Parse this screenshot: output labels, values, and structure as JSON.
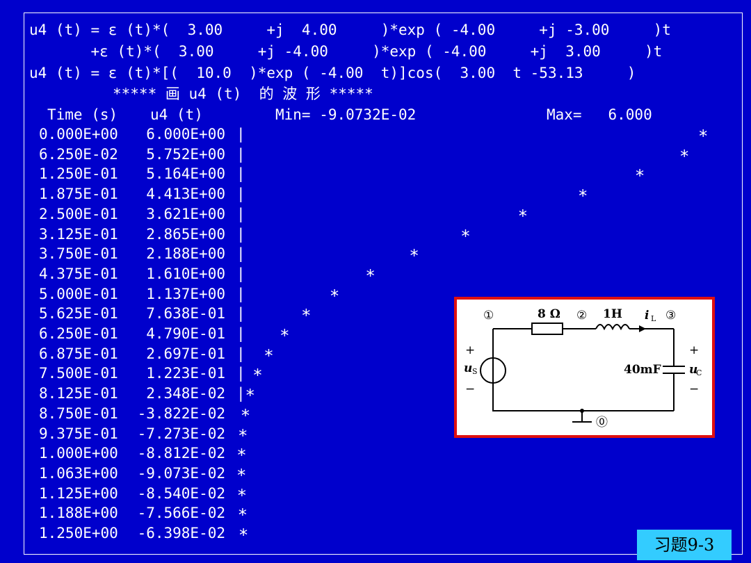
{
  "header": {
    "line1": "u4 (t) = ε (t)*(  3.00     +j  4.00     )*exp ( -4.00     +j -3.00     )t",
    "line2": "       +ε (t)*(  3.00     +j -4.00     )*exp ( -4.00     +j  3.00     )t",
    "line3": "u4 (t) = ε (t)*[(  10.0  )*exp ( -4.00  t)]cos(  3.00  t -53.13     )",
    "plot_title": "***** 画 u4 (t)  的 波 形 *****",
    "col_time": "Time (s)",
    "col_u": "u4 (t)",
    "min_label": "Min= -9.0732E-02",
    "max_label": "Max=   6.000"
  },
  "rows": [
    {
      "t": "0.000E+00",
      "u": "6.000E+00",
      "v": 6.0
    },
    {
      "t": "6.250E-02",
      "u": "5.752E+00",
      "v": 5.752
    },
    {
      "t": "1.250E-01",
      "u": "5.164E+00",
      "v": 5.164
    },
    {
      "t": "1.875E-01",
      "u": "4.413E+00",
      "v": 4.413
    },
    {
      "t": "2.500E-01",
      "u": "3.621E+00",
      "v": 3.621
    },
    {
      "t": "3.125E-01",
      "u": "2.865E+00",
      "v": 2.865
    },
    {
      "t": "3.750E-01",
      "u": "2.188E+00",
      "v": 2.188
    },
    {
      "t": "4.375E-01",
      "u": "1.610E+00",
      "v": 1.61
    },
    {
      "t": "5.000E-01",
      "u": "1.137E+00",
      "v": 1.137
    },
    {
      "t": "5.625E-01",
      "u": "7.638E-01",
      "v": 0.7638
    },
    {
      "t": "6.250E-01",
      "u": "4.790E-01",
      "v": 0.479
    },
    {
      "t": "6.875E-01",
      "u": "2.697E-01",
      "v": 0.2697
    },
    {
      "t": "7.500E-01",
      "u": "1.223E-01",
      "v": 0.1223
    },
    {
      "t": "8.125E-01",
      "u": "2.348E-02",
      "v": 0.02348
    },
    {
      "t": "8.750E-01",
      "u": "-3.822E-02",
      "v": -0.03822
    },
    {
      "t": "9.375E-01",
      "u": "-7.273E-02",
      "v": -0.07273
    },
    {
      "t": "1.000E+00",
      "u": "-8.812E-02",
      "v": -0.08812
    },
    {
      "t": "1.063E+00",
      "u": "-9.073E-02",
      "v": -0.09073
    },
    {
      "t": "1.125E+00",
      "u": "-8.540E-02",
      "v": -0.0854
    },
    {
      "t": "1.188E+00",
      "u": "-7.566E-02",
      "v": -0.07566
    },
    {
      "t": "1.250E+00",
      "u": "-6.398E-02",
      "v": -0.06398
    }
  ],
  "plot": {
    "min": -0.090732,
    "max": 6.0
  },
  "star_symbol": "*",
  "axis_symbol": "|",
  "circuit": {
    "node1": "①",
    "node2": "②",
    "node3": "③",
    "node0": "⓪",
    "resistor": "8 Ω",
    "inductor": "1H",
    "current": "i",
    "current_sub": "L",
    "capacitor": "40mF",
    "source": "u",
    "source_sub": "S",
    "cap_voltage": "u",
    "cap_voltage_sub": "C",
    "plus": "+",
    "minus": "−"
  },
  "exercise_tag": "习题9-3",
  "colors": {
    "background": "#0000cc",
    "text": "#ffffff",
    "circuit_border": "#e01010",
    "tag_bg": "#33ccff"
  }
}
